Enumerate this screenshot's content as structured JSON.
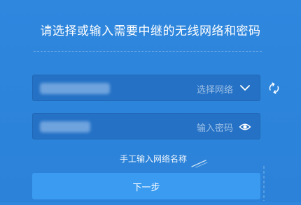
{
  "header": {
    "title": "请选择或输入需要中继的无线网络和密码"
  },
  "network_field": {
    "label": "选择网络",
    "value_obscured": true,
    "chevron_icon": "chevron-down-icon",
    "refresh_icon": "refresh-icon"
  },
  "password_field": {
    "label": "输入密码",
    "value_obscured": true,
    "visibility_icon": "eye-icon"
  },
  "manual_link": {
    "label": "手工输入网络名称"
  },
  "next_button": {
    "label": "下一步"
  },
  "colors": {
    "background": "#2f86dc",
    "field_bg": "#2471c5",
    "button_bg": "#3a9bf0",
    "text": "#ffffff"
  }
}
